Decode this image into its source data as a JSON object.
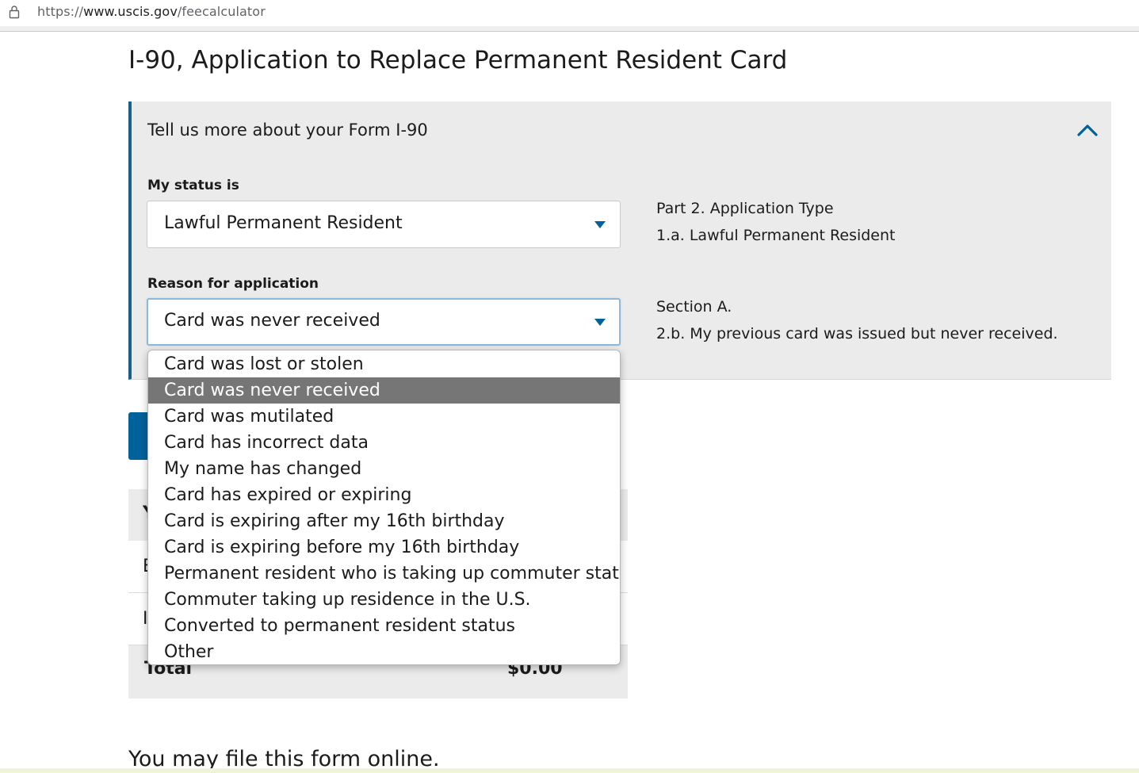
{
  "browser": {
    "url_scheme": "https://",
    "url_host": "www.uscis.gov",
    "url_path": "/feecalculator"
  },
  "page": {
    "title": "I-90, Application to Replace Permanent Resident Card"
  },
  "panel": {
    "heading": "Tell us more about your Form I-90",
    "status_label": "My status is",
    "status_value": "Lawful Permanent Resident",
    "reason_label": "Reason for application",
    "reason_value": "Card was never received",
    "status_info": [
      "Part 2. Application Type",
      "1.a. Lawful Permanent Resident"
    ],
    "reason_info": [
      "Section A.",
      "2.b. My previous card was issued but never received."
    ]
  },
  "dropdown": {
    "options": [
      "Card was lost or stolen",
      "Card was never received",
      "Card was mutilated",
      "Card has incorrect data",
      "My name has changed",
      "Card has expired or expiring",
      "Card is expiring after my 16th birthday",
      "Card is expiring before my 16th birthday",
      "Permanent resident who is taking up commuter status",
      "Commuter taking up residence in the U.S.",
      "Converted to permanent resident status",
      "Other"
    ],
    "selected_index": 1
  },
  "fees": {
    "header_partial": "Y",
    "row1_partial": "E",
    "row2_partial": "I",
    "total_label": "Total",
    "total_value": "$0.00"
  },
  "footer": {
    "online_title": "You may file this form online."
  },
  "colors": {
    "accent_blue": "#00629b",
    "panel_border": "#1a5e8a",
    "panel_bg": "#ebebeb",
    "selected_option_bg": "#767676"
  }
}
